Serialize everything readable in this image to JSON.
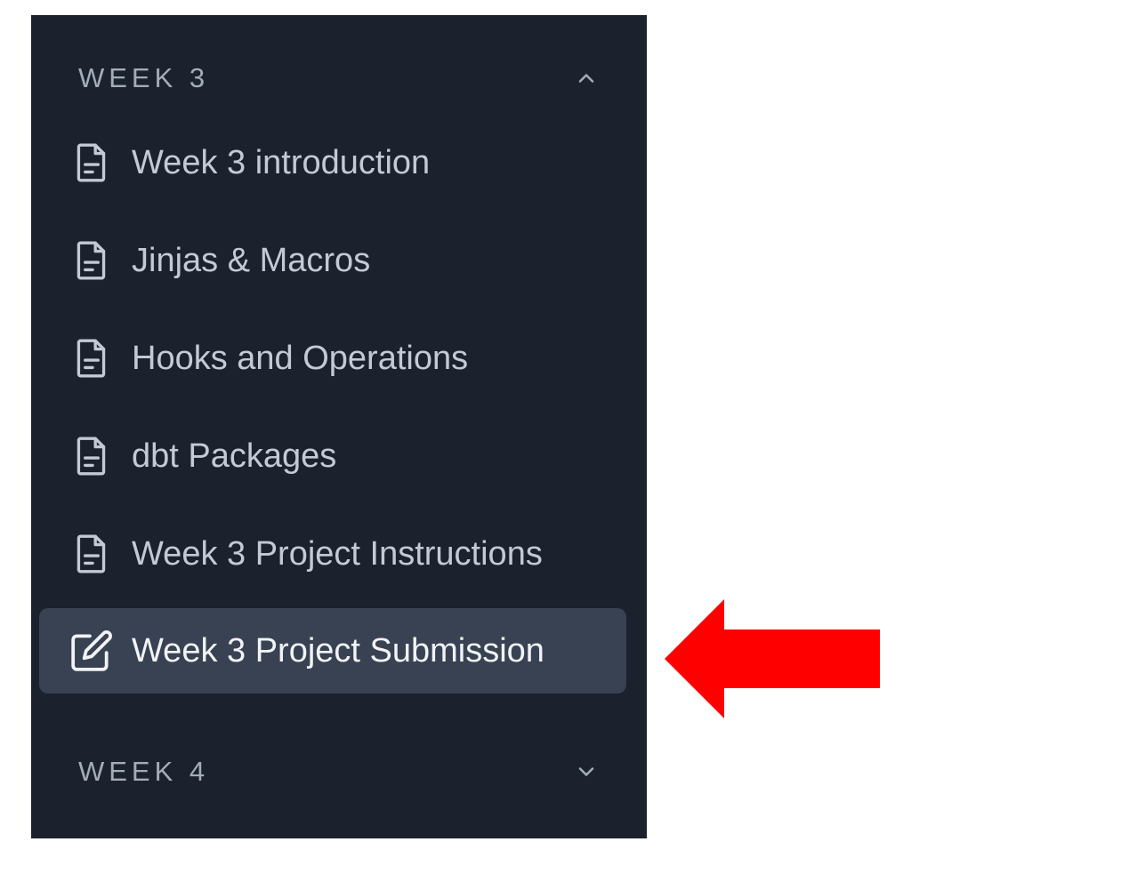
{
  "sidebar": {
    "sections": [
      {
        "title": "WEEK 3",
        "expanded": true,
        "chevron_icon": "chevron-up-icon"
      },
      {
        "title": "WEEK 4",
        "expanded": false,
        "chevron_icon": "chevron-down-icon"
      }
    ],
    "items": [
      {
        "label": "Week 3 introduction",
        "icon": "document-icon",
        "active": false
      },
      {
        "label": "Jinjas & Macros",
        "icon": "document-icon",
        "active": false
      },
      {
        "label": "Hooks and Operations",
        "icon": "document-icon",
        "active": false
      },
      {
        "label": "dbt Packages",
        "icon": "document-icon",
        "active": false
      },
      {
        "label": "Week 3 Project Instructions",
        "icon": "document-icon",
        "active": false
      },
      {
        "label": "Week 3 Project Submission",
        "icon": "edit-icon",
        "active": true
      }
    ]
  },
  "annotation": {
    "icon": "arrow-left-icon",
    "color": "#fe0000"
  },
  "colors": {
    "sidebar_bg": "#1b212d",
    "active_item_bg": "#384252",
    "text": "#c3cad5",
    "section_title": "#a3acb9"
  }
}
